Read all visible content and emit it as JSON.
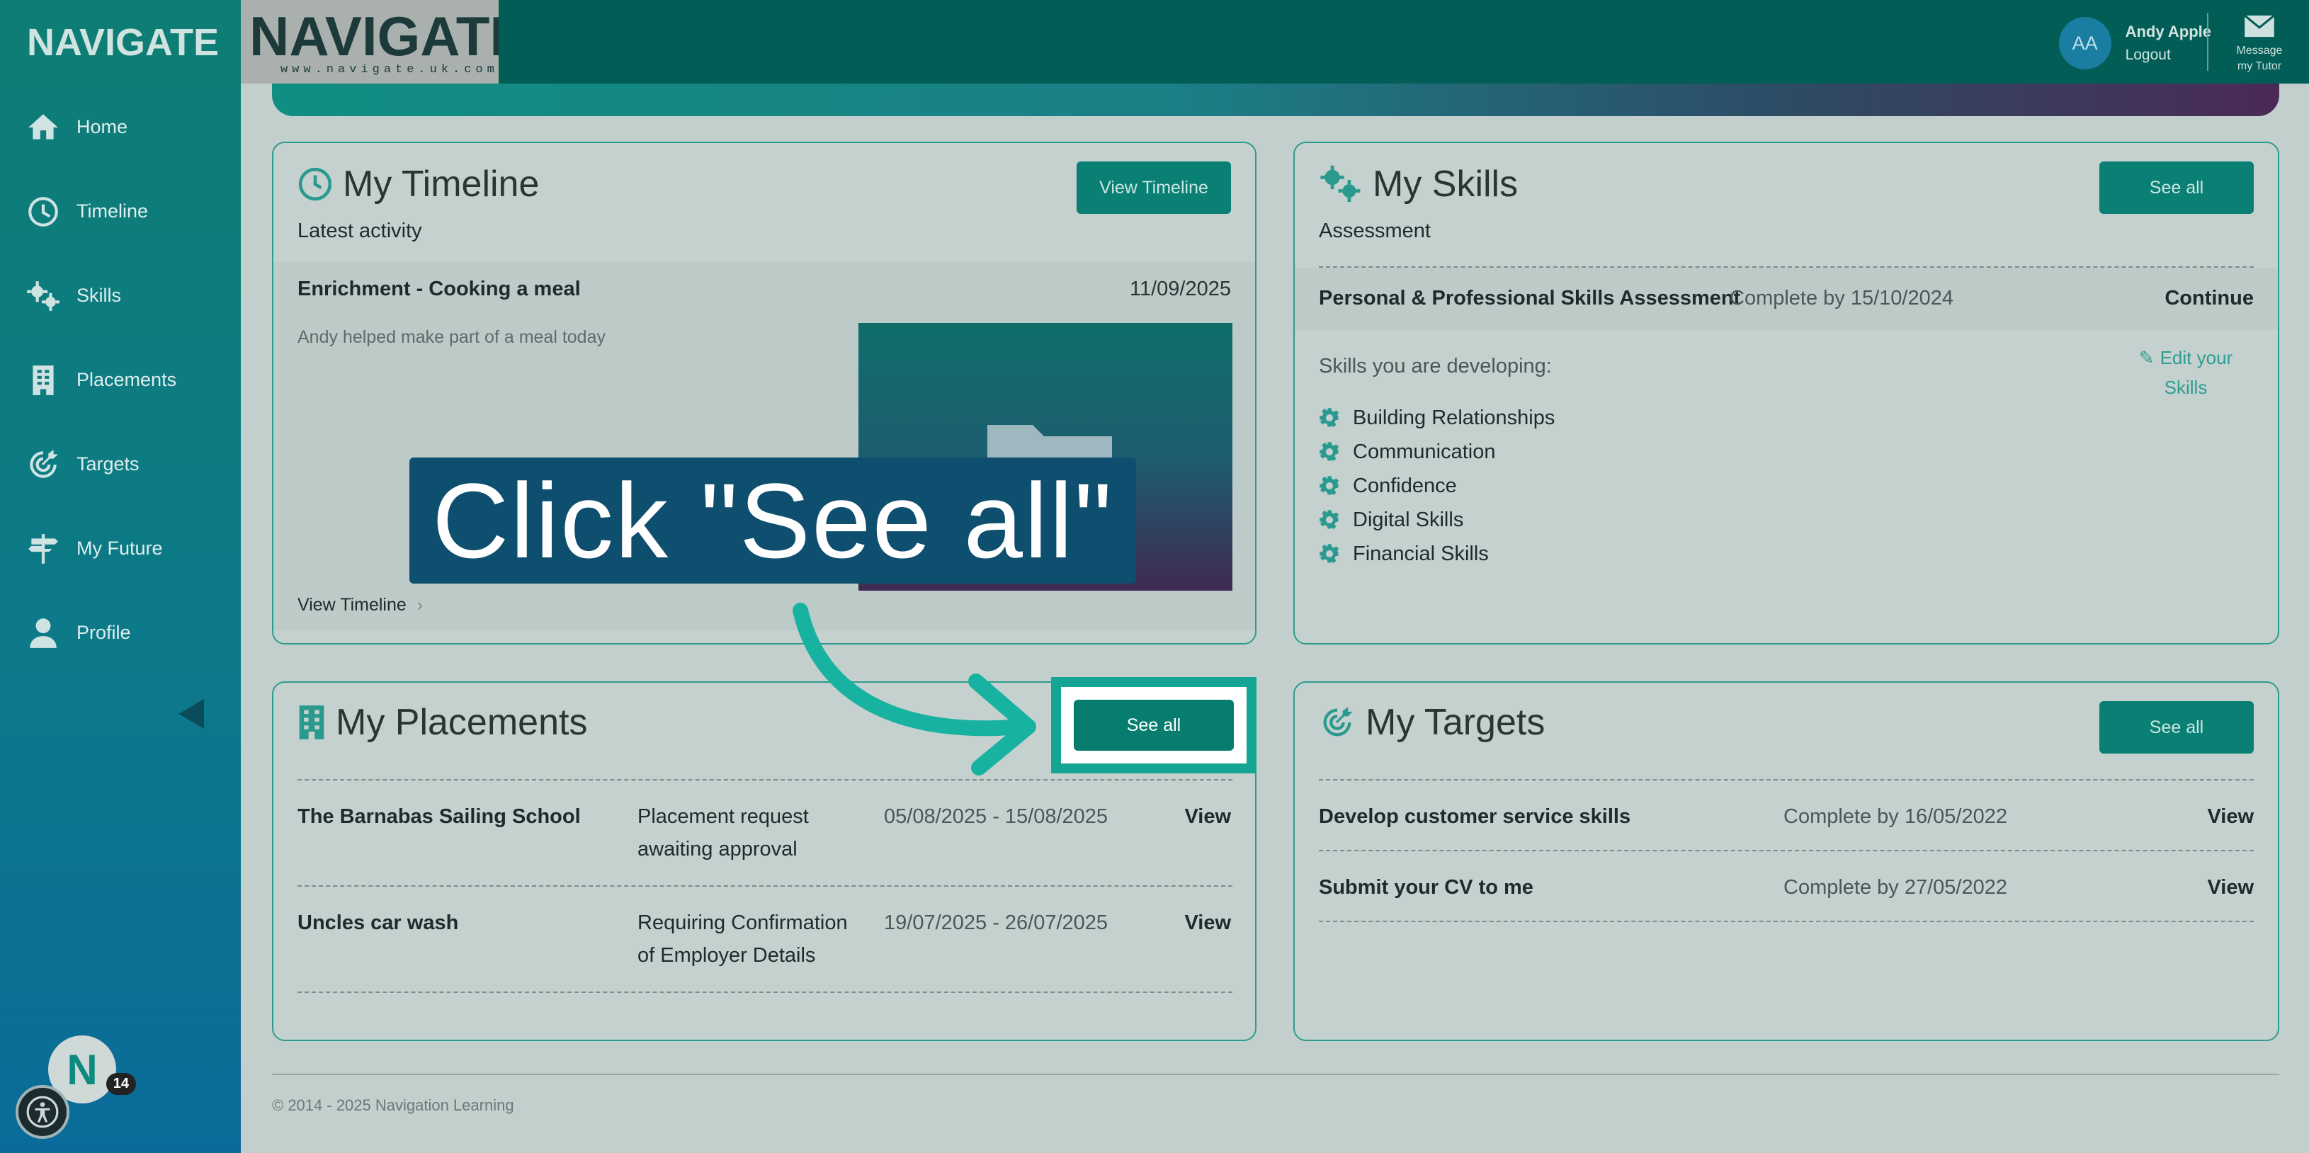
{
  "brand": {
    "logo_text": "NAVIGATE",
    "logo_url_text": "www.navigate.uk.com"
  },
  "sidebar": {
    "items": [
      {
        "label": "Home",
        "icon": "home-icon"
      },
      {
        "label": "Timeline",
        "icon": "clock-icon"
      },
      {
        "label": "Skills",
        "icon": "gears-icon"
      },
      {
        "label": "Placements",
        "icon": "building-icon"
      },
      {
        "label": "Targets",
        "icon": "target-icon"
      },
      {
        "label": "My Future",
        "icon": "signpost-icon"
      },
      {
        "label": "Profile",
        "icon": "user-icon"
      }
    ],
    "notification_letter": "N",
    "notification_count": "14"
  },
  "header": {
    "avatar_initials": "AA",
    "user_name": "Andy Apple",
    "logout": "Logout",
    "message_line1": "Message",
    "message_line2": "my Tutor"
  },
  "timeline": {
    "title": "My Timeline",
    "button": "View Timeline",
    "subtitle": "Latest activity",
    "activity_title": "Enrichment - Cooking a meal",
    "activity_date": "11/09/2025",
    "activity_desc": "Andy helped make part of a meal today",
    "link": "View Timeline"
  },
  "skills": {
    "title": "My Skills",
    "button": "See all",
    "subtitle": "Assessment",
    "assessment_name": "Personal & Professional Skills Assessment",
    "assessment_due": "Complete by 15/10/2024",
    "assessment_action": "Continue",
    "developing_label": "Skills you are developing:",
    "edit_line1": "Edit your",
    "edit_line2": "Skills",
    "list": [
      "Building Relationships",
      "Communication",
      "Confidence",
      "Digital Skills",
      "Financial Skills"
    ]
  },
  "placements": {
    "title": "My Placements",
    "button": "See all",
    "rows": [
      {
        "name": "The Barnabas Sailing School",
        "status1": "Placement request",
        "status2": "awaiting approval",
        "dates": "05/08/2025 - 15/08/2025",
        "action": "View"
      },
      {
        "name": "Uncles car wash",
        "status1": "Requiring Confirmation",
        "status2": "of Employer Details",
        "dates": "19/07/2025 - 26/07/2025",
        "action": "View"
      }
    ]
  },
  "targets": {
    "title": "My Targets",
    "button": "See all",
    "rows": [
      {
        "name": "Develop customer service skills",
        "due": "Complete by 16/05/2022",
        "action": "View"
      },
      {
        "name": "Submit your CV to me",
        "due": "Complete by 27/05/2022",
        "action": "View"
      }
    ]
  },
  "footer": {
    "text": "© 2014 - 2025 Navigation Learning"
  },
  "overlay": {
    "callout": "Click \"See all\"",
    "highlight_button": "See all"
  },
  "colors": {
    "primary": "#0a7f73",
    "header": "#015d55",
    "highlight": "#14a594",
    "callout": "#0e4e6e"
  }
}
